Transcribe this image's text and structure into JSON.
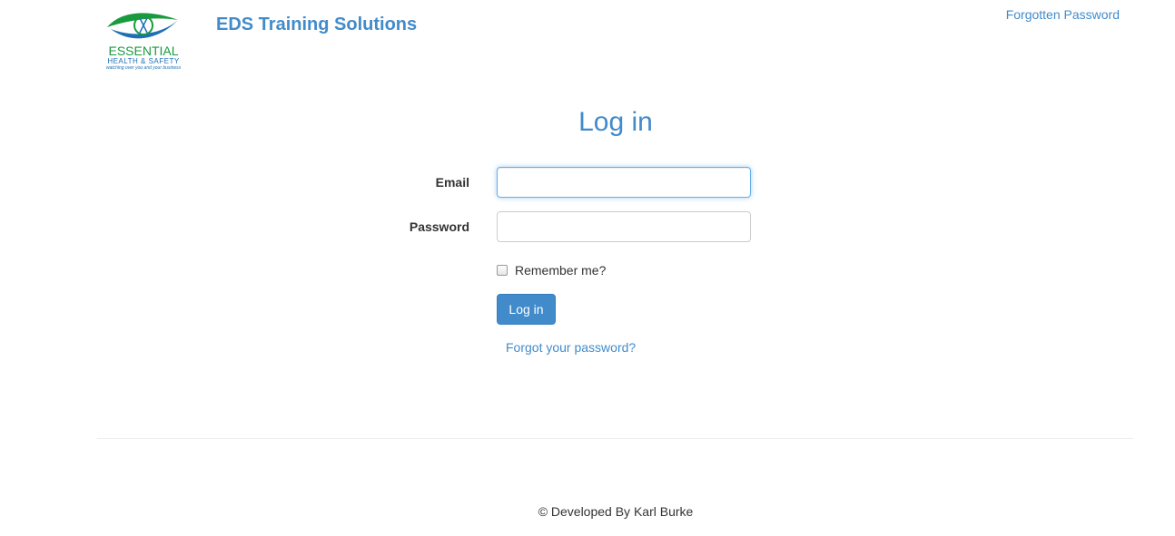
{
  "header": {
    "logo": {
      "name": "ESSENTIAL",
      "sub": "HEALTH & SAFETY",
      "tagline": "watching over you and your business"
    },
    "brand": "EDS Training Solutions",
    "forgotten_password_link": "Forgotten Password"
  },
  "form": {
    "title": "Log in",
    "email_label": "Email",
    "email_value": "",
    "password_label": "Password",
    "password_value": "",
    "remember_label": "Remember me?",
    "remember_checked": false,
    "submit_label": "Log in",
    "forgot_link": "Forgot your password?"
  },
  "footer": {
    "text": "© Developed By Karl Burke"
  },
  "colors": {
    "brand_blue": "#428bca",
    "logo_green": "#1a9a3e",
    "logo_blue": "#1e6fb5"
  }
}
